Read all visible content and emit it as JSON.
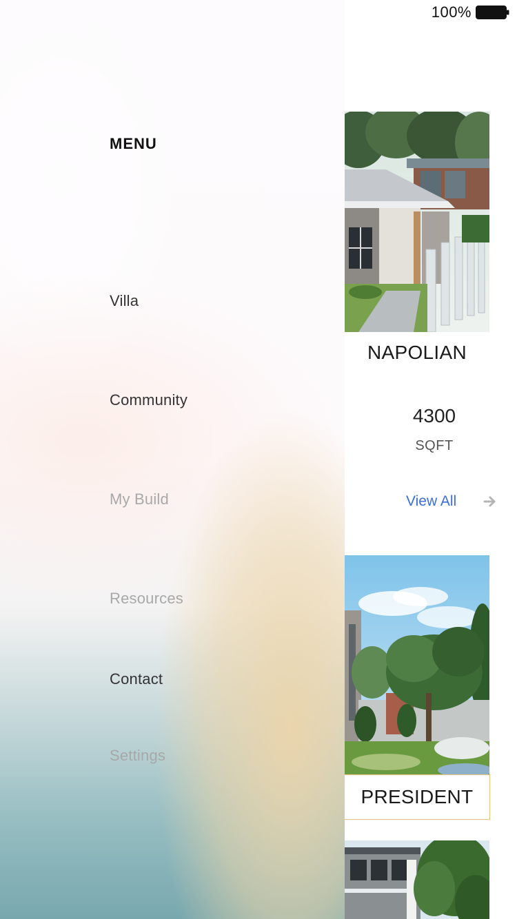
{
  "status_bar": {
    "battery_percent": "100%"
  },
  "menu": {
    "title": "MENU",
    "items": [
      {
        "label": "Villa",
        "style": "active"
      },
      {
        "label": "Community",
        "style": "active"
      },
      {
        "label": "My Build",
        "style": "muted"
      },
      {
        "label": "Resources",
        "style": "muted"
      },
      {
        "label": "Contact",
        "style": "active"
      },
      {
        "label": "Settings",
        "style": "muted"
      }
    ]
  },
  "listing": {
    "featured": {
      "name": "NAPOLIAN",
      "area_value": "4300",
      "area_unit": "SQFT"
    },
    "view_all_label": "View All",
    "second": {
      "name": "PRESIDENT"
    }
  },
  "colors": {
    "link": "#3a6fd8",
    "menu_active": "#333333",
    "menu_muted": "#a8a8a8",
    "card_border": "#e8c27a"
  },
  "icons": {
    "battery": "battery-full-icon",
    "arrow": "arrow-right-icon"
  }
}
